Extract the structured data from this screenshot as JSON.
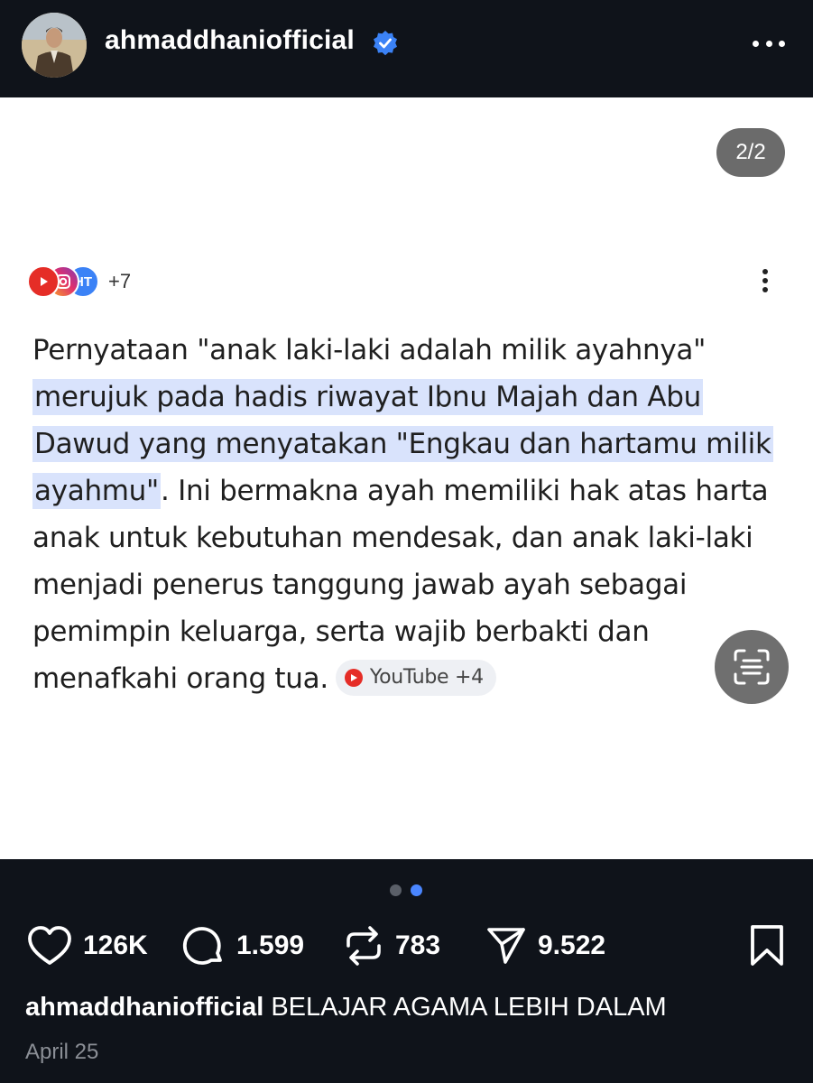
{
  "header": {
    "username": "ahmaddhaniofficial",
    "verified": true,
    "icons": [
      "verified-badge-icon",
      "more-icon"
    ]
  },
  "post": {
    "counter": "2/2",
    "sources_more": "+7",
    "source_icons": [
      "youtube-icon",
      "instagram-icon",
      "ht-icon"
    ],
    "answer_lines": [
      {
        "pre": "Pernyataan \"anak laki-laki adalah milik ayahnya\"",
        "hl": "",
        "post": ""
      },
      {
        "pre": "",
        "hl": "merujuk pada hadis riwayat Ibnu Majah dan Abu",
        "post": ""
      },
      {
        "pre": "",
        "hl": "Dawud yang menyatakan \"Engkau dan hartamu milik",
        "post": ""
      },
      {
        "pre": "",
        "hl": "ayahmu\"",
        "post": ". Ini bermakna ayah memiliki hak atas harta"
      },
      {
        "pre": "anak untuk kebutuhan mendesak, dan anak laki-laki",
        "hl": "",
        "post": ""
      },
      {
        "pre": "menjadi penerus tanggung jawab ayah sebagai",
        "hl": "",
        "post": ""
      },
      {
        "pre": "pemimpin keluarga, serta wajib berbakti dan",
        "hl": "",
        "post": ""
      },
      {
        "pre": "menafkahi orang tua.",
        "hl": "",
        "post": ""
      }
    ],
    "chip_label": "YouTube +4",
    "highlight_color": "#d9e3fc"
  },
  "carousel": {
    "total": 2,
    "active": 2
  },
  "actions": {
    "likes": "126K",
    "comments": "1.599",
    "reposts": "783",
    "shares": "9.522"
  },
  "caption": {
    "username": "ahmaddhaniofficial",
    "text": "BELAJAR AGAMA LEBIH DALAM"
  },
  "date": "April 25",
  "colors": {
    "background": "#0f131a",
    "accent": "#4a86ff",
    "verified": "#3b82f6"
  }
}
